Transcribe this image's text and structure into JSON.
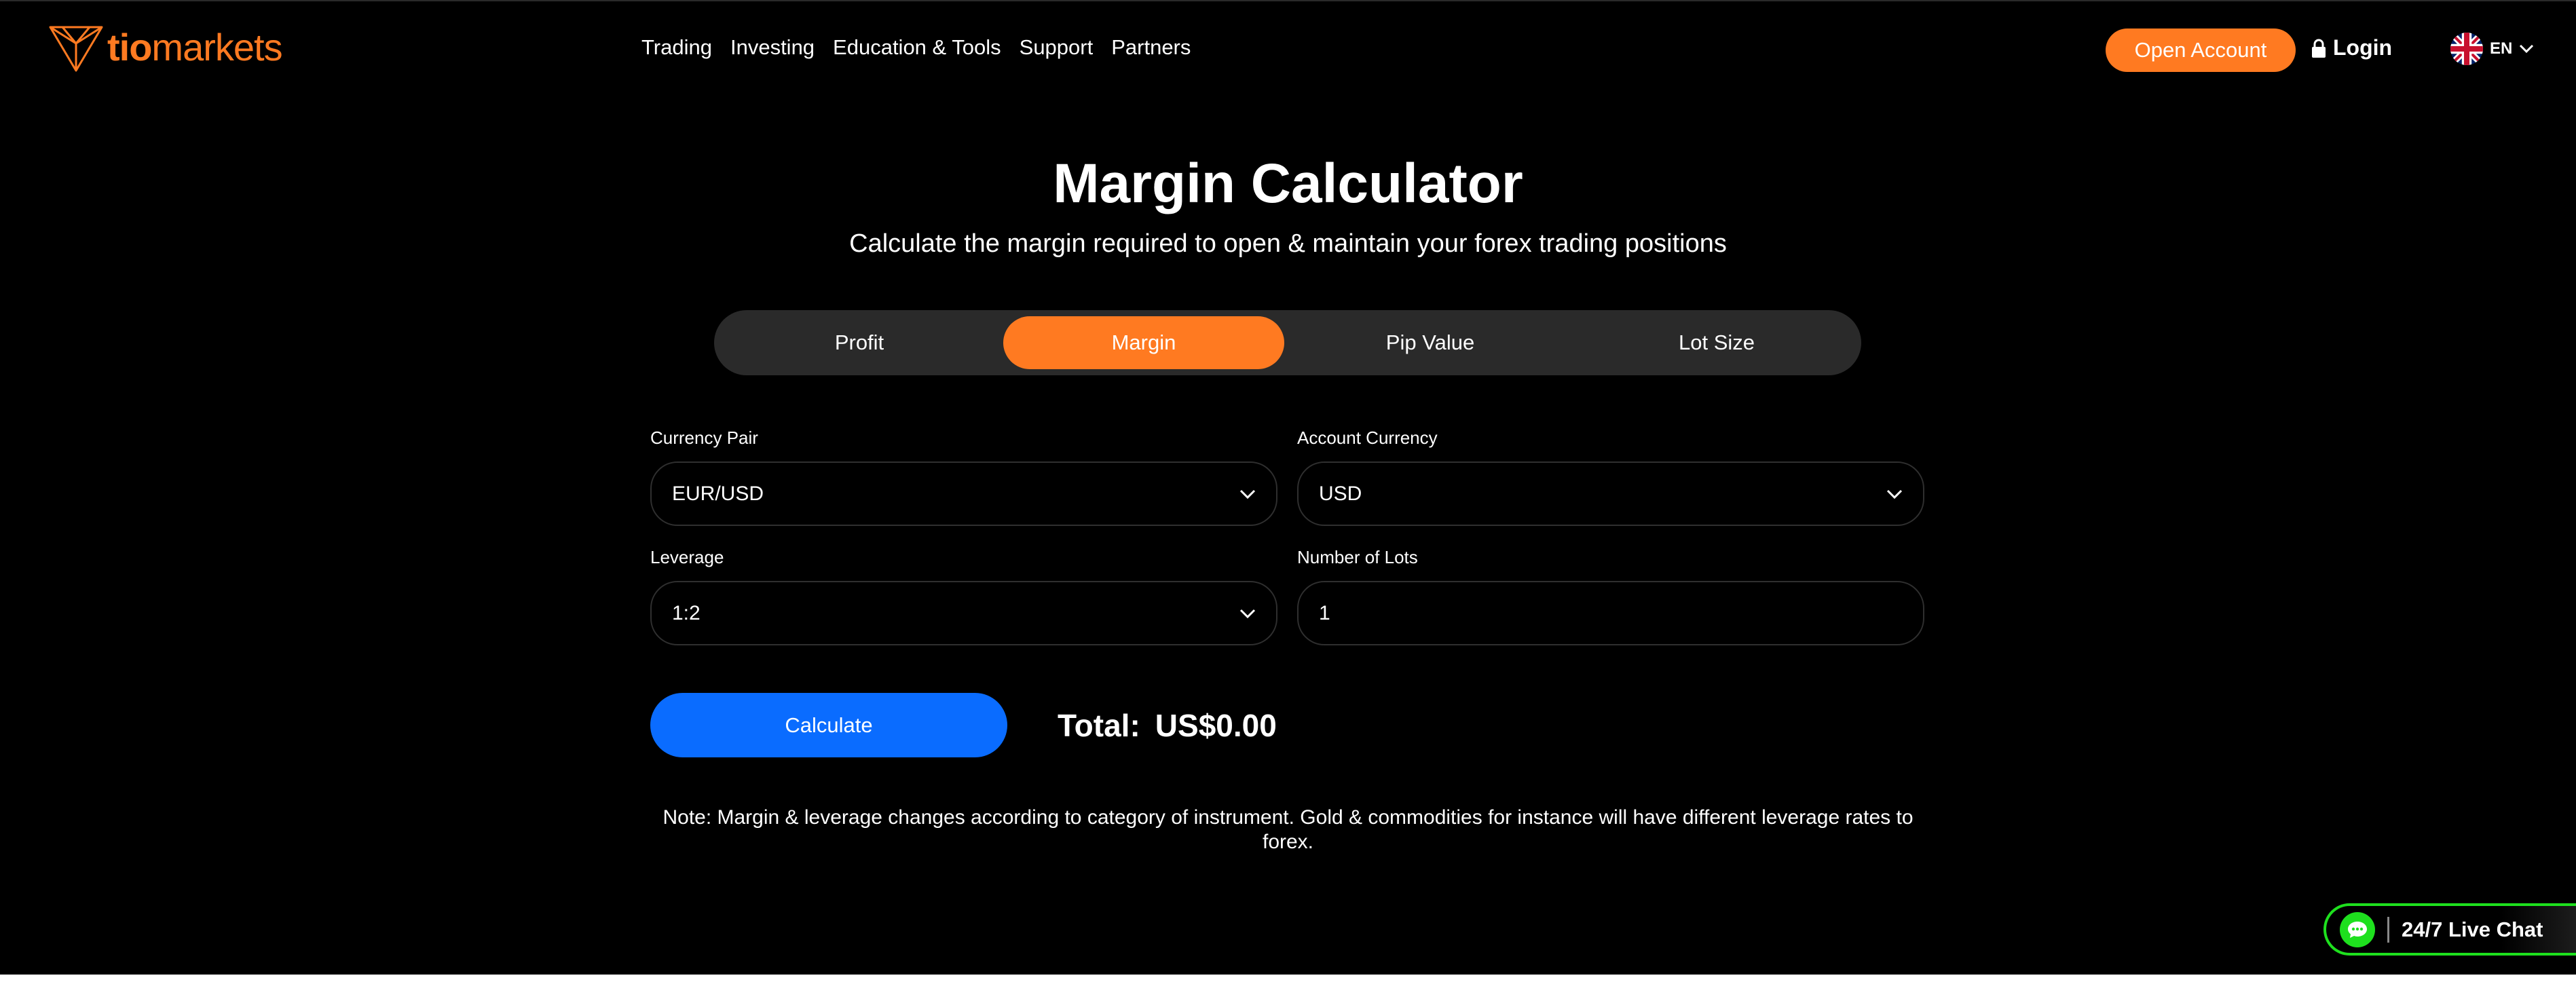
{
  "header": {
    "logo": {
      "part1": "tio",
      "part2": "markets",
      "icon": "tiomarkets-logo-icon"
    },
    "nav": [
      "Trading",
      "Investing",
      "Education & Tools",
      "Support",
      "Partners"
    ],
    "open_account": "Open Account",
    "login": "Login",
    "language": "EN"
  },
  "hero": {
    "title": "Margin Calculator",
    "subtitle": "Calculate the margin required to open & maintain your forex trading positions"
  },
  "tabs": [
    {
      "label": "Profit",
      "active": false
    },
    {
      "label": "Margin",
      "active": true
    },
    {
      "label": "Pip Value",
      "active": false
    },
    {
      "label": "Lot Size",
      "active": false
    }
  ],
  "form": {
    "currency_pair": {
      "label": "Currency Pair",
      "value": "EUR/USD"
    },
    "account_currency": {
      "label": "Account Currency",
      "value": "USD"
    },
    "leverage": {
      "label": "Leverage",
      "value": "1:2"
    },
    "number_of_lots": {
      "label": "Number of Lots",
      "value": "1"
    }
  },
  "calculate_label": "Calculate",
  "total": {
    "label": "Total:",
    "value": "US$0.00"
  },
  "note": "Note: Margin & leverage changes according to category of instrument. Gold & commodities for instance will have different leverage rates to forex.",
  "live_chat": {
    "label": "24/7 Live Chat",
    "icon": "chat-bubble-icon"
  },
  "colors": {
    "background": "#000000",
    "accent": "#ff7a21",
    "button_primary": "#0a6cff",
    "tab_track": "#2a2a2a",
    "live_chat_border": "#1ee01e"
  }
}
